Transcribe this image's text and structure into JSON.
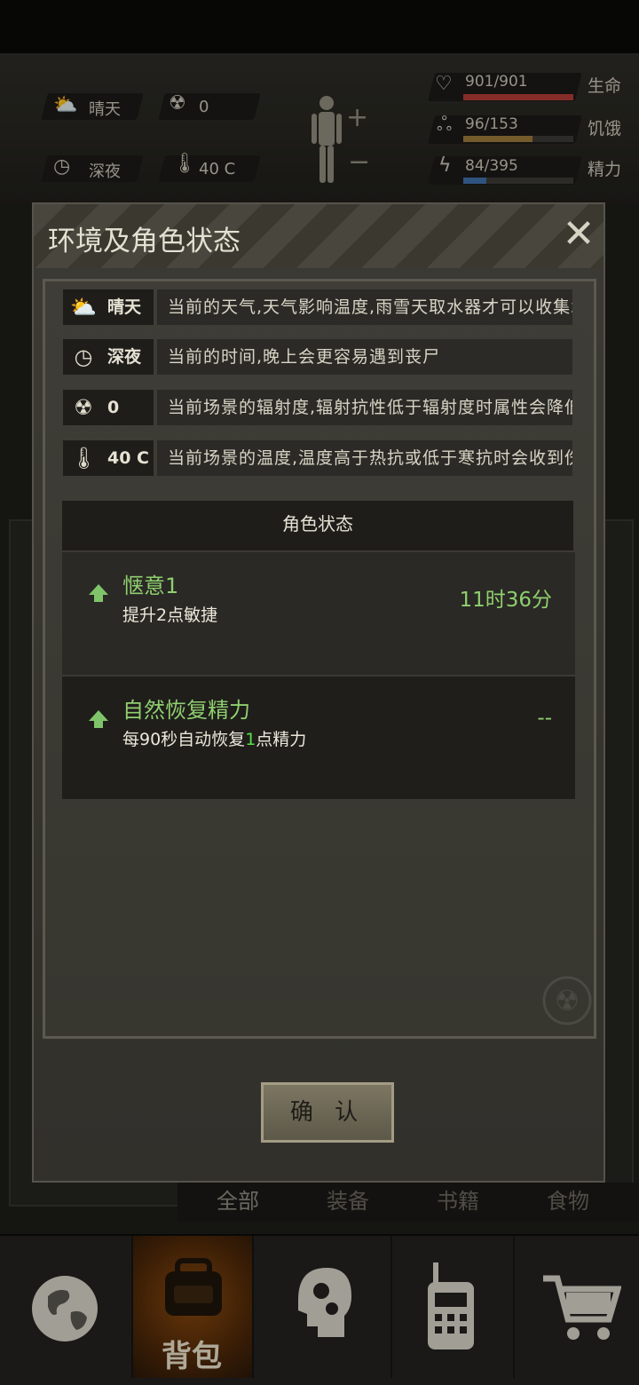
{
  "hud": {
    "weather": "晴天",
    "radiation": "0",
    "time": "深夜",
    "temperature": "40 C",
    "health": {
      "value": "901/901",
      "label": "生命",
      "fill": 1.0,
      "color": "#b23b36"
    },
    "hunger": {
      "value": "96/153",
      "label": "饥饿",
      "fill": 0.63,
      "color": "#9a7a3a"
    },
    "energy": {
      "value": "84/395",
      "label": "精力",
      "fill": 0.21,
      "color": "#3f6fa8"
    }
  },
  "modal": {
    "title": "环境及角色状态",
    "close_icon": "close-icon",
    "env": [
      {
        "icon": "sun-cloud-icon",
        "value": "晴天",
        "desc": "当前的天气,天气影响温度,雨雪天取水器才可以收集水"
      },
      {
        "icon": "clock-icon",
        "value": "深夜",
        "desc": "当前的时间,晚上会更容易遇到丧尸"
      },
      {
        "icon": "radiation-icon",
        "value": "0",
        "desc": "当前场景的辐射度,辐射抗性低于辐射度时属性会降低"
      },
      {
        "icon": "thermometer-icon",
        "value": "40 C",
        "desc": "当前场景的温度,温度高于热抗或低于寒抗时会收到伤害"
      }
    ],
    "section_title": "角色状态",
    "statuses": [
      {
        "name": "惬意1",
        "desc": "提升2点敏捷",
        "time": "11时36分"
      },
      {
        "name": "自然恢复精力",
        "desc_before": "每90秒自动恢复",
        "desc_highlight": "1",
        "desc_after": "点精力",
        "time": "--"
      }
    ],
    "confirm": "确 认"
  },
  "tabs": [
    "全部",
    "装备",
    "书籍",
    "食物"
  ],
  "nav": {
    "active_label": "背包",
    "icons": [
      "globe-icon",
      "backpack-icon",
      "head-gears-icon",
      "walkie-talkie-icon",
      "cart-icon"
    ]
  }
}
